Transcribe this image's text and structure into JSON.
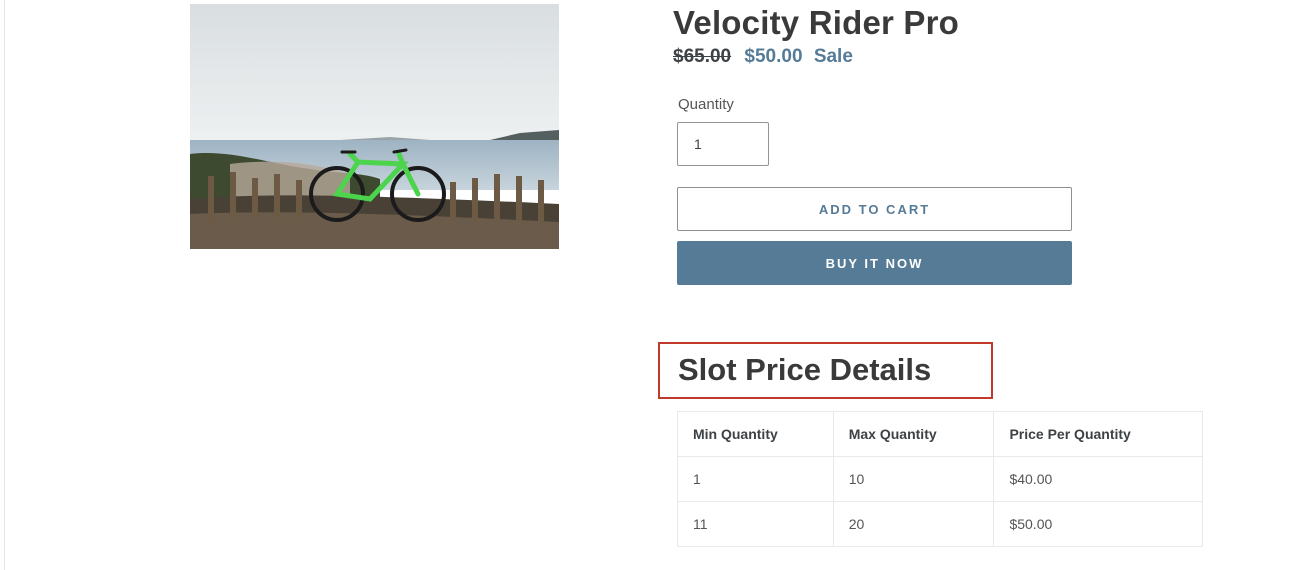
{
  "product": {
    "title": "Velocity Rider Pro",
    "image_subject": "green road bicycle by the sea",
    "price_regular": "$65.00",
    "price_sale": "$50.00",
    "sale_label": "Sale"
  },
  "quantity": {
    "label": "Quantity",
    "value": "1"
  },
  "buttons": {
    "add_to_cart": "ADD TO CART",
    "buy_now": "BUY IT NOW"
  },
  "slot_prices": {
    "heading": "Slot Price Details",
    "columns": [
      "Min Quantity",
      "Max Quantity",
      "Price Per Quantity"
    ],
    "rows": [
      [
        "1",
        "10",
        "$40.00"
      ],
      [
        "11",
        "20",
        "$50.00"
      ]
    ]
  },
  "colors": {
    "accent": "#557b97",
    "highlight_border": "#c0392b",
    "bike_green": "#4cd44c"
  }
}
